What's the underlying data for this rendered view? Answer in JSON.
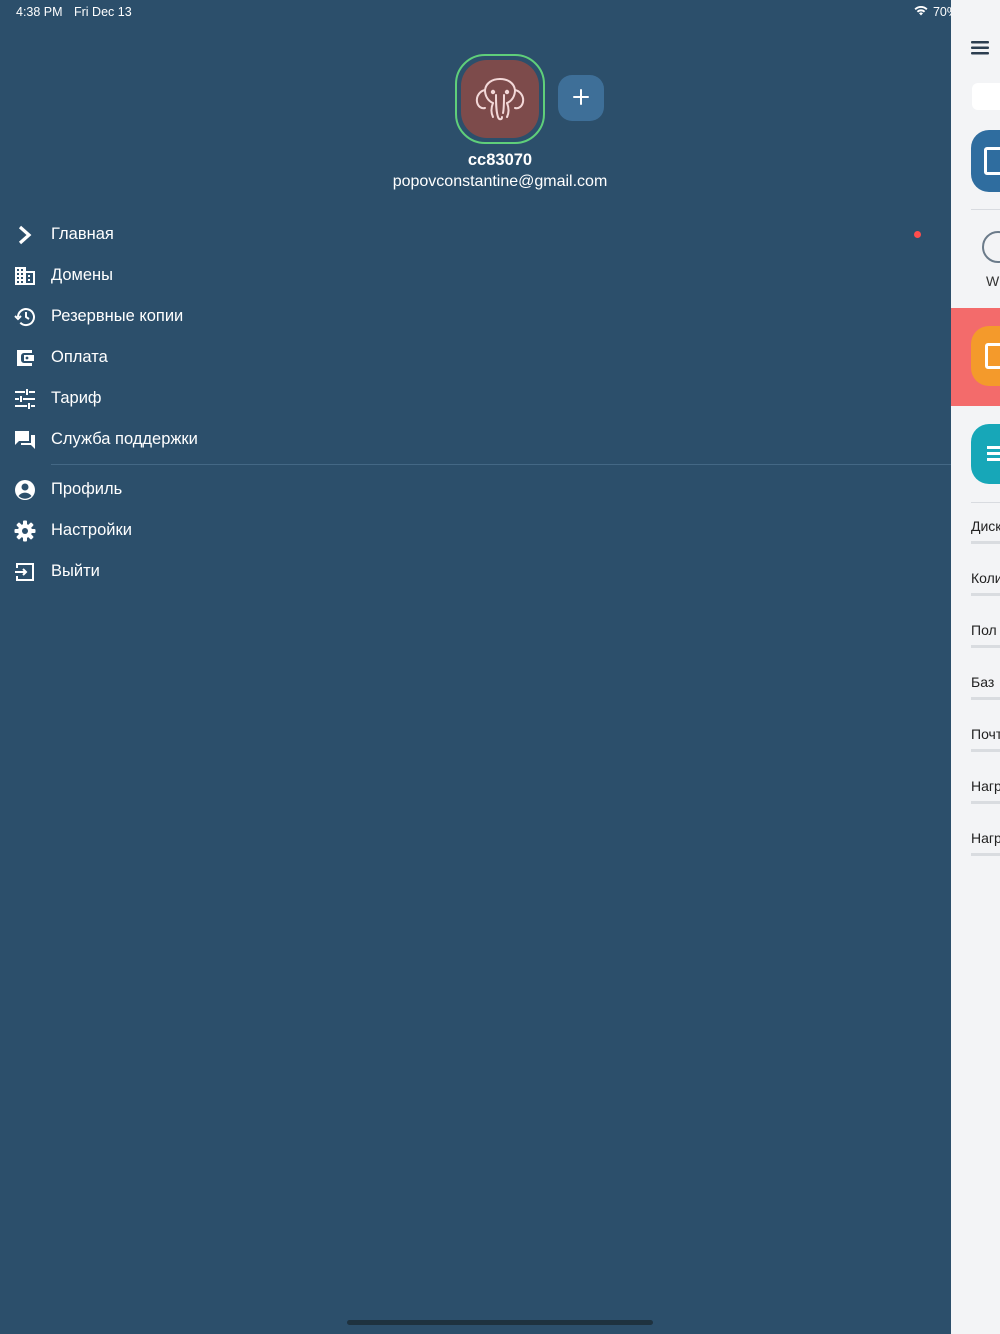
{
  "status_bar": {
    "time": "4:38 PM",
    "date": "Fri Dec 13",
    "battery": "70%",
    "battery_level": 0.7
  },
  "profile": {
    "username": "cc83070",
    "email": "popovconstantine@gmail.com"
  },
  "menu": {
    "items": [
      {
        "label": "Главная",
        "icon": "chevron-right-icon"
      },
      {
        "label": "Домены",
        "icon": "building-icon"
      },
      {
        "label": "Резервные копии",
        "icon": "history-icon"
      },
      {
        "label": "Оплата",
        "icon": "wallet-icon"
      },
      {
        "label": "Тариф",
        "icon": "sliders-icon"
      },
      {
        "label": "Служба поддержки",
        "icon": "chat-icon"
      }
    ],
    "account_items": [
      {
        "label": "Профиль",
        "icon": "account-circle-icon"
      },
      {
        "label": "Настройки",
        "icon": "gear-icon"
      },
      {
        "label": "Выйти",
        "icon": "logout-icon"
      }
    ]
  },
  "main_peek": {
    "w_label": "W",
    "rows": [
      "Диск",
      "Коли",
      "Пол",
      "Баз",
      "Почт",
      "Нагр",
      "Нагр"
    ]
  },
  "colors": {
    "drawer_bg": "#2c4f6b",
    "accent_green": "#5fcf7a",
    "notification_red": "#ff4d4d"
  }
}
